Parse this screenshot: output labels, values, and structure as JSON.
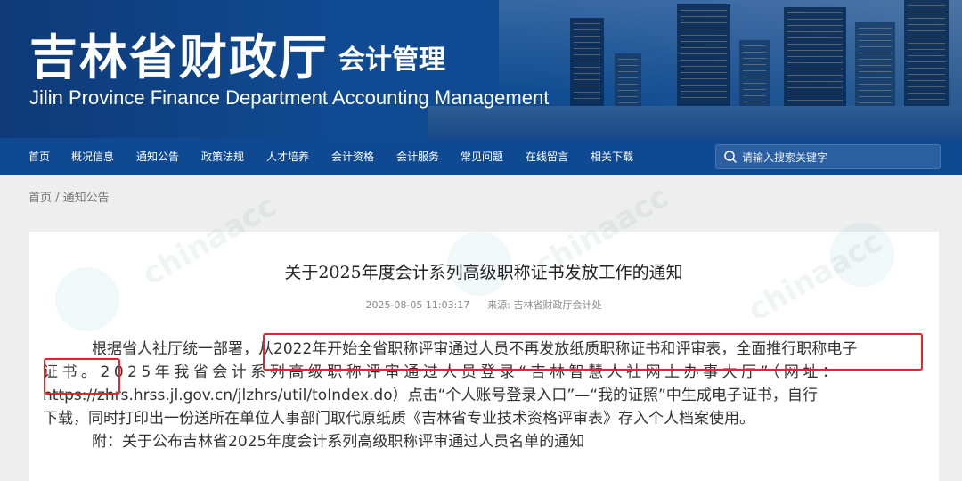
{
  "header": {
    "title": "吉林省财政厅",
    "subtitle": "会计管理",
    "english": "Jilin Province Finance Department Accounting Management"
  },
  "nav": {
    "items": [
      "首页",
      "概况信息",
      "通知公告",
      "政策法规",
      "人才培养",
      "会计资格",
      "会计服务",
      "常见问题",
      "在线留言",
      "相关下载"
    ],
    "search_placeholder": "请输入搜索关键字"
  },
  "breadcrumb": {
    "home": "首页",
    "separator": " / ",
    "current": "通知公告"
  },
  "article": {
    "title": "关于2025年度会计系列高级职称证书发放工作的通知",
    "date": "2025-08-05 11:03:17",
    "source_label": "来源:",
    "source": "吉林省财政厅会计处",
    "para1_line1": "根据省人社厅统一部署，从2022年开始全省职称评审通过人员不再发放纸质职称证书和评审表，全面推行职称电子",
    "para1_line2": "证书。2025年我省会计系列高级职称评审通过人员登录“吉林智慧人社网上办事大厅”（网址：",
    "para1_line3": "https://zhrs.hrss.jl.gov.cn/jlzhrs/util/toIndex.do）点击“个人账号登录入口”—“我的证照”中生成电子证书，自行",
    "para1_line4": "下载，同时打印出一份送所在单位人事部门取代原纸质《吉林省专业技术资格评审表》存入个人档案使用。",
    "attachment": "附：关于公布吉林省2025年度会计系列高级职称评审通过人员名单的通知"
  },
  "colors": {
    "nav_bg": "#0f4992",
    "highlight_border": "#e8232a"
  }
}
